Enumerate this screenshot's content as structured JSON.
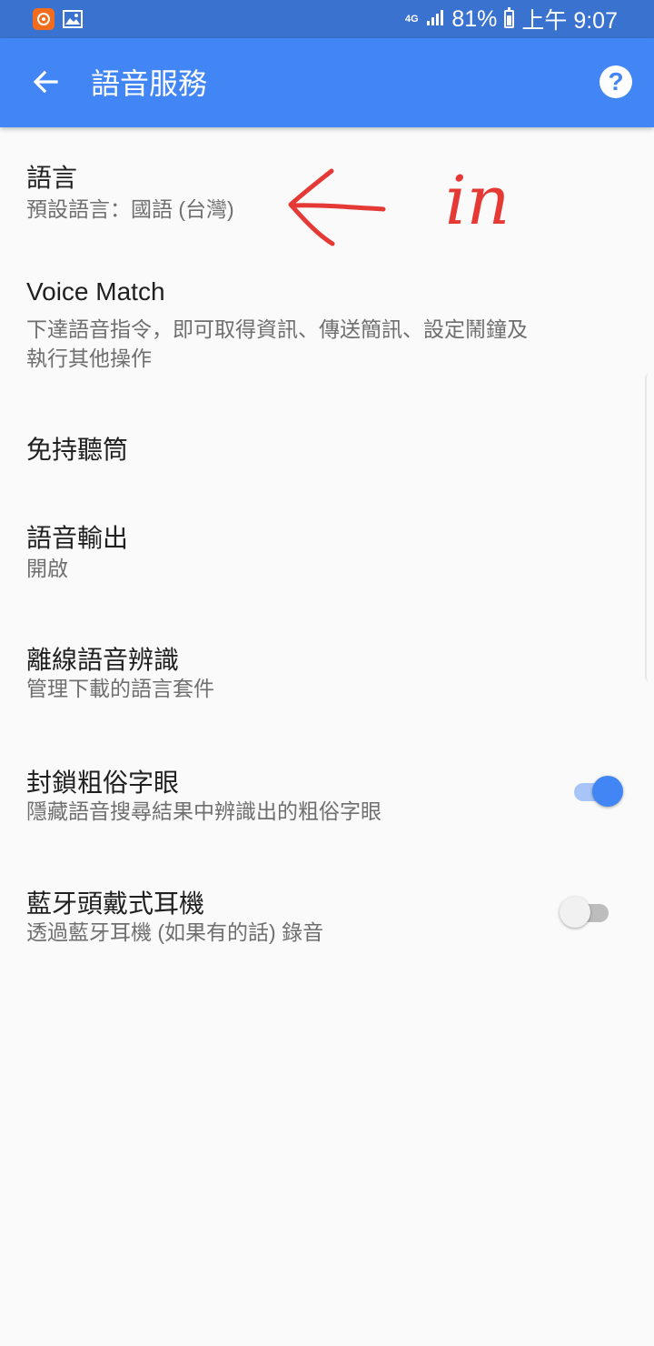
{
  "status_bar": {
    "network": "4G",
    "battery": "81%",
    "battery_level": 0.81,
    "time": "上午 9:07",
    "icons": [
      "app-notification-icon",
      "image-notification-icon",
      "signal-icon",
      "battery-icon"
    ]
  },
  "app_bar": {
    "title": "語音服務",
    "back_icon": "arrow-back-icon",
    "help_icon": "help-icon"
  },
  "settings": {
    "language": {
      "title": "語言",
      "subtitle": "預設語言：國語 (台灣)"
    },
    "voice_match": {
      "title": "Voice Match",
      "subtitle": "下達語音指令，即可取得資訊、傳送簡訊、設定鬧鐘及執行其他操作"
    },
    "hands_free": {
      "title": "免持聽筒"
    },
    "speech_output": {
      "title": "語音輸出",
      "subtitle": "開啟"
    },
    "offline_recognition": {
      "title": "離線語音辨識",
      "subtitle": "管理下載的語言套件"
    },
    "block_offensive": {
      "title": "封鎖粗俗字眼",
      "subtitle": "隱藏語音搜尋結果中辨識出的粗俗字眼",
      "enabled": true
    },
    "bluetooth_headset": {
      "title": "藍牙頭戴式耳機",
      "subtitle": "透過藍牙耳機 (如果有的話) 錄音",
      "enabled": false
    }
  },
  "annotation": {
    "text": "in",
    "color": "#e53935"
  },
  "colors": {
    "status_bar": "#3a73cf",
    "app_bar": "#4285f4",
    "accent": "#4285f4",
    "background": "#fafafa"
  }
}
